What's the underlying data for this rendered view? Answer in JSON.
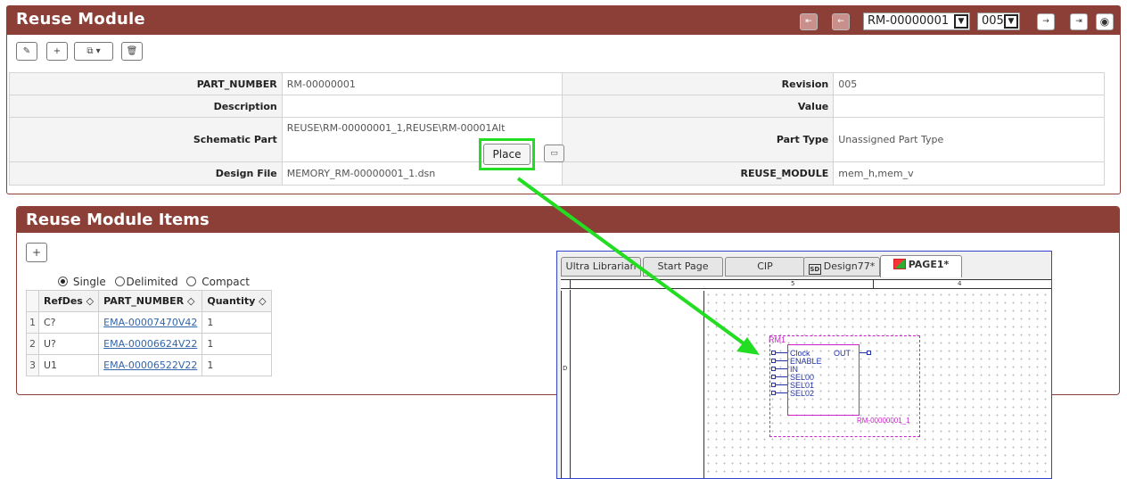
{
  "header": {
    "title": "Reuse Module",
    "part_select": "RM-00000001",
    "rev_select": "005",
    "nav": {
      "first": "⇤",
      "prev": "←",
      "next": "→",
      "last": "⇥",
      "circle": "◉"
    }
  },
  "toolbar": {
    "edit": "✎",
    "add": "+",
    "copy": "⧉ ▾",
    "delete": "🗑"
  },
  "properties": {
    "part_number_label": "PART_NUMBER",
    "part_number_value": "RM-00000001",
    "revision_label": "Revision",
    "revision_value": "005",
    "description_label": "Description",
    "description_value": "",
    "value_label": "Value",
    "value_value": "",
    "schematic_part_label": "Schematic Part",
    "schematic_part_value": "REUSE\\RM-00000001_1,REUSE\\RM-00001Alt",
    "place_label": "Place",
    "part_type_label": "Part Type",
    "part_type_value": "Unassigned Part Type",
    "design_file_label": "Design File",
    "design_file_value": "MEMORY_RM-00000001_1.dsn",
    "reuse_module_label": "REUSE_MODULE",
    "reuse_module_value": "mem_h,mem_v"
  },
  "items": {
    "title": "Reuse Module Items",
    "add": "+",
    "radio": {
      "single": "Single",
      "delimited": "Delimited",
      "compact": "Compact",
      "selected": "single"
    },
    "columns": [
      "RefDes ◇",
      "PART_NUMBER ◇",
      "Quantity ◇"
    ],
    "rows": [
      {
        "idx": "1",
        "refdes": "C?",
        "part": "EMA-00007470V42",
        "qty": "1"
      },
      {
        "idx": "2",
        "refdes": "U?",
        "part": "EMA-00006624V22",
        "qty": "1"
      },
      {
        "idx": "3",
        "refdes": "U1",
        "part": "EMA-00006522V22",
        "qty": "1"
      }
    ]
  },
  "schematic": {
    "tabs": [
      "Ultra Librarian",
      "Start Page",
      "CIP",
      "Design77*",
      "PAGE1*"
    ],
    "ruler": {
      "r5": "5",
      "r4": "4",
      "d": "D"
    },
    "part_ref": "RM1",
    "pins_left": [
      "Clock",
      "ENABLE",
      "IN",
      "SEL00",
      "SEL01",
      "SEL02"
    ],
    "pin_right": "OUT",
    "part_name": "RM-00000001_1"
  },
  "colors": {
    "brand": "#8b3f36",
    "highlight": "#22dd22",
    "part": "#cc22cc",
    "pin": "#2233aa"
  }
}
